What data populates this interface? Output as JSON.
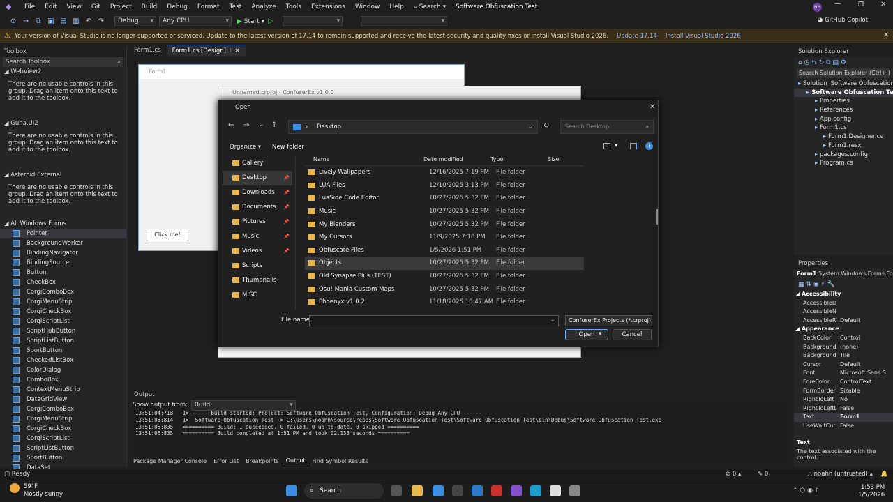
{
  "menubar": {
    "items": [
      "File",
      "Edit",
      "View",
      "Git",
      "Project",
      "Build",
      "Debug",
      "Format",
      "Test",
      "Analyze",
      "Tools",
      "Extensions",
      "Window",
      "Help"
    ],
    "search_label": "Search",
    "solution_title": "Software Obfuscation Test",
    "user_badge": "NH"
  },
  "toolbar": {
    "config": "Debug",
    "platform": "Any CPU",
    "start_label": "Start",
    "copilot_label": "GitHub Copilot"
  },
  "infobar": {
    "message": "Your version of Visual Studio is no longer supported or serviced. Update to the latest version of 17.14 to remain supported and receive the latest security and quality fixes or install Visual Studio 2026.",
    "link1": "Update 17.14",
    "link2": "Install Visual Studio 2026"
  },
  "toolbox": {
    "title": "Toolbox",
    "search_placeholder": "Search Toolbox",
    "groups": [
      {
        "name": "WebView2",
        "message": "There are no usable controls in this group. Drag an item onto this text to add it to the toolbox."
      },
      {
        "name": "Guna.UI2",
        "message": "There are no usable controls in this group. Drag an item onto this text to add it to the toolbox."
      },
      {
        "name": "Asteroid External",
        "message": "There are no usable controls in this group. Drag an item onto this text to add it to the toolbox."
      }
    ],
    "all_group": "All Windows Forms",
    "items": [
      "Pointer",
      "BackgroundWorker",
      "BindingNavigator",
      "BindingSource",
      "Button",
      "CheckBox",
      "CorgiComboBox",
      "CorgiMenuStrip",
      "CorgiCheckBox",
      "CorgiScriptList",
      "ScriptHubButton",
      "ScriptListButton",
      "SportButton",
      "CheckedListBox",
      "ColorDialog",
      "ComboBox",
      "ContextMenuStrip",
      "DataGridView",
      "CorgiComboBox",
      "CorgiMenuStrip",
      "CorgiCheckBox",
      "CorgiScriptList",
      "ScriptListButton",
      "SportButton",
      "DataSet"
    ]
  },
  "doctabs": {
    "tab1": "Form1.cs",
    "tab2": "Form1.cs [Design]"
  },
  "form1": {
    "title": "Form1",
    "button": "Click me!"
  },
  "confuser": {
    "title": "Unnamed.crproj - ConfuserEx v1.0.0"
  },
  "open_dialog": {
    "title": "Open",
    "address": "Desktop",
    "search_placeholder": "Search Desktop",
    "organize": "Organize",
    "new_folder": "New folder",
    "nav": [
      {
        "label": "Gallery",
        "pinned": false
      },
      {
        "label": "Desktop",
        "pinned": true,
        "selected": true
      },
      {
        "label": "Downloads",
        "pinned": true
      },
      {
        "label": "Documents",
        "pinned": true
      },
      {
        "label": "Pictures",
        "pinned": true
      },
      {
        "label": "Music",
        "pinned": true
      },
      {
        "label": "Videos",
        "pinned": true
      },
      {
        "label": "Scripts",
        "pinned": false
      },
      {
        "label": "Thumbnails",
        "pinned": false
      },
      {
        "label": "MISC",
        "pinned": false
      }
    ],
    "columns": [
      "Name",
      "Date modified",
      "Type",
      "Size"
    ],
    "files": [
      {
        "name": "Lively Wallpapers",
        "date": "12/16/2025 7:19 PM",
        "type": "File folder"
      },
      {
        "name": "LUA Files",
        "date": "12/10/2025 3:13 PM",
        "type": "File folder"
      },
      {
        "name": "LuaSide Code Editor",
        "date": "10/27/2025 5:32 PM",
        "type": "File folder"
      },
      {
        "name": "Music",
        "date": "10/27/2025 5:32 PM",
        "type": "File folder"
      },
      {
        "name": "My Blenders",
        "date": "10/27/2025 5:32 PM",
        "type": "File folder"
      },
      {
        "name": "My Cursors",
        "date": "11/9/2025 7:18 PM",
        "type": "File folder"
      },
      {
        "name": "Obfuscate Files",
        "date": "1/5/2026 1:51 PM",
        "type": "File folder"
      },
      {
        "name": "Objects",
        "date": "10/27/2025 5:32 PM",
        "type": "File folder",
        "hover": true
      },
      {
        "name": "Old Synapse Plus (TEST)",
        "date": "10/27/2025 5:32 PM",
        "type": "File folder"
      },
      {
        "name": "Osu! Mania Custom Maps",
        "date": "10/27/2025 5:32 PM",
        "type": "File folder"
      },
      {
        "name": "Phoenyx v1.0.2",
        "date": "11/18/2025 10:47 AM",
        "type": "File folder"
      }
    ],
    "file_name_label": "File name:",
    "file_name_value": "",
    "file_type": "ConfuserEx Projects (*.crproj)",
    "open_btn": "Open",
    "cancel_btn": "Cancel"
  },
  "solution_explorer": {
    "title": "Solution Explorer",
    "search_placeholder": "Search Solution Explorer (Ctrl+;)",
    "items": [
      {
        "label": "Solution 'Software Obfuscation Test'",
        "indent": 0
      },
      {
        "label": "Software Obfuscation Test",
        "indent": 1,
        "bold": true
      },
      {
        "label": "Properties",
        "indent": 2
      },
      {
        "label": "References",
        "indent": 2
      },
      {
        "label": "App.config",
        "indent": 2
      },
      {
        "label": "Form1.cs",
        "indent": 2
      },
      {
        "label": "Form1.Designer.cs",
        "indent": 3
      },
      {
        "label": "Form1.resx",
        "indent": 3
      },
      {
        "label": "packages.config",
        "indent": 2
      },
      {
        "label": "Program.cs",
        "indent": 2
      }
    ]
  },
  "properties": {
    "title": "Properties",
    "object": "Form1",
    "object_type": "System.Windows.Forms.Fo",
    "categories": {
      "accessibility": "Accessibility",
      "appearance": "Appearance"
    },
    "access_rows": [
      {
        "k": "AccessibleDesc",
        "v": ""
      },
      {
        "k": "AccessibleNam",
        "v": ""
      },
      {
        "k": "AccessibleRole",
        "v": "Default"
      }
    ],
    "appear_rows": [
      {
        "k": "BackColor",
        "v": "Control"
      },
      {
        "k": "BackgroundIm",
        "v": "(none)"
      },
      {
        "k": "BackgroundIm",
        "v": "Tile"
      },
      {
        "k": "Cursor",
        "v": "Default"
      },
      {
        "k": "Font",
        "v": "Microsoft Sans S"
      },
      {
        "k": "ForeColor",
        "v": "ControlText"
      },
      {
        "k": "FormBorderSty",
        "v": "Sizable"
      },
      {
        "k": "RightToLeft",
        "v": "No"
      },
      {
        "k": "RightToLeftLay",
        "v": "False"
      },
      {
        "k": "Text",
        "v": "Form1"
      },
      {
        "k": "UseWaitCursor",
        "v": "False"
      }
    ],
    "desc_title": "Text",
    "desc_text": "The text associated with the control."
  },
  "output": {
    "title": "Output",
    "show_from_label": "Show output from:",
    "show_from_value": "Build",
    "lines": [
      "13:51:04:718   1>------ Build started: Project: Software Obfuscation Test, Configuration: Debug Any CPU ------",
      "13:51:05:814   1>  Software Obfuscation Test -> C:\\Users\\noahh\\source\\repos\\Software Obfuscation Test\\Software Obfuscation Test\\bin\\Debug\\Software Obfuscation Test.exe",
      "13:51:05:835   ========== Build: 1 succeeded, 0 failed, 0 up-to-date, 0 skipped ==========",
      "13:51:05:835   ========== Build completed at 1:51 PM and took 02.133 seconds =========="
    ]
  },
  "bottom_tabs": [
    "Package Manager Console",
    "Error List",
    "Breakpoints",
    "Output",
    "Find Symbol Results"
  ],
  "statusbar": {
    "ready": "Ready",
    "errors": "0",
    "changes": "0",
    "user": "noahh (untrusted)"
  },
  "taskbar": {
    "weather_temp": "59°F",
    "weather_desc": "Mostly sunny",
    "search": "Search",
    "time": "1:53 PM",
    "date": "1/5/2026"
  }
}
